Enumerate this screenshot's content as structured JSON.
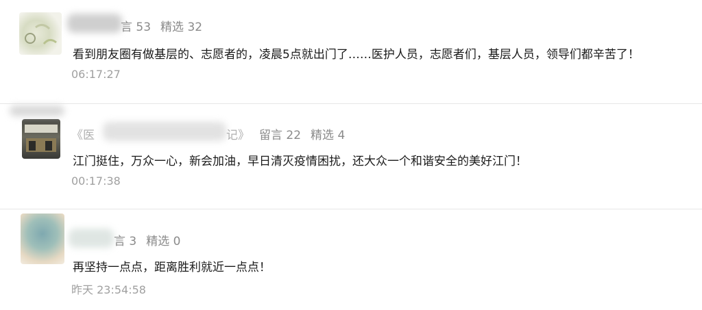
{
  "comments": [
    {
      "name_hidden": "",
      "meta_partial": "言 53",
      "featured": "精选 32",
      "content": "看到朋友圈有做基层的、志愿者的，凌晨5点就出门了……医护人员，志愿者们，基层人员，领导们都辛苦了！",
      "time": "06:17:27"
    },
    {
      "name_partial_left": "《医",
      "name_partial_right": "记》",
      "reply": "留言 22",
      "featured": "精选 4",
      "content": "江门挺住，万众一心，新会加油，早日清灭疫情困扰，还大众一个和谐安全的美好江门！",
      "time": "00:17:38"
    },
    {
      "meta_partial": "言 3",
      "featured": "精选 0",
      "content": "再坚持一点点，距离胜利就近一点点！",
      "time": "昨天 23:54:58"
    }
  ],
  "colors": {
    "meta": "#8a8a8a",
    "time": "#a0a0a0",
    "text": "#1a1a1a",
    "divider": "#e6e6e6"
  }
}
